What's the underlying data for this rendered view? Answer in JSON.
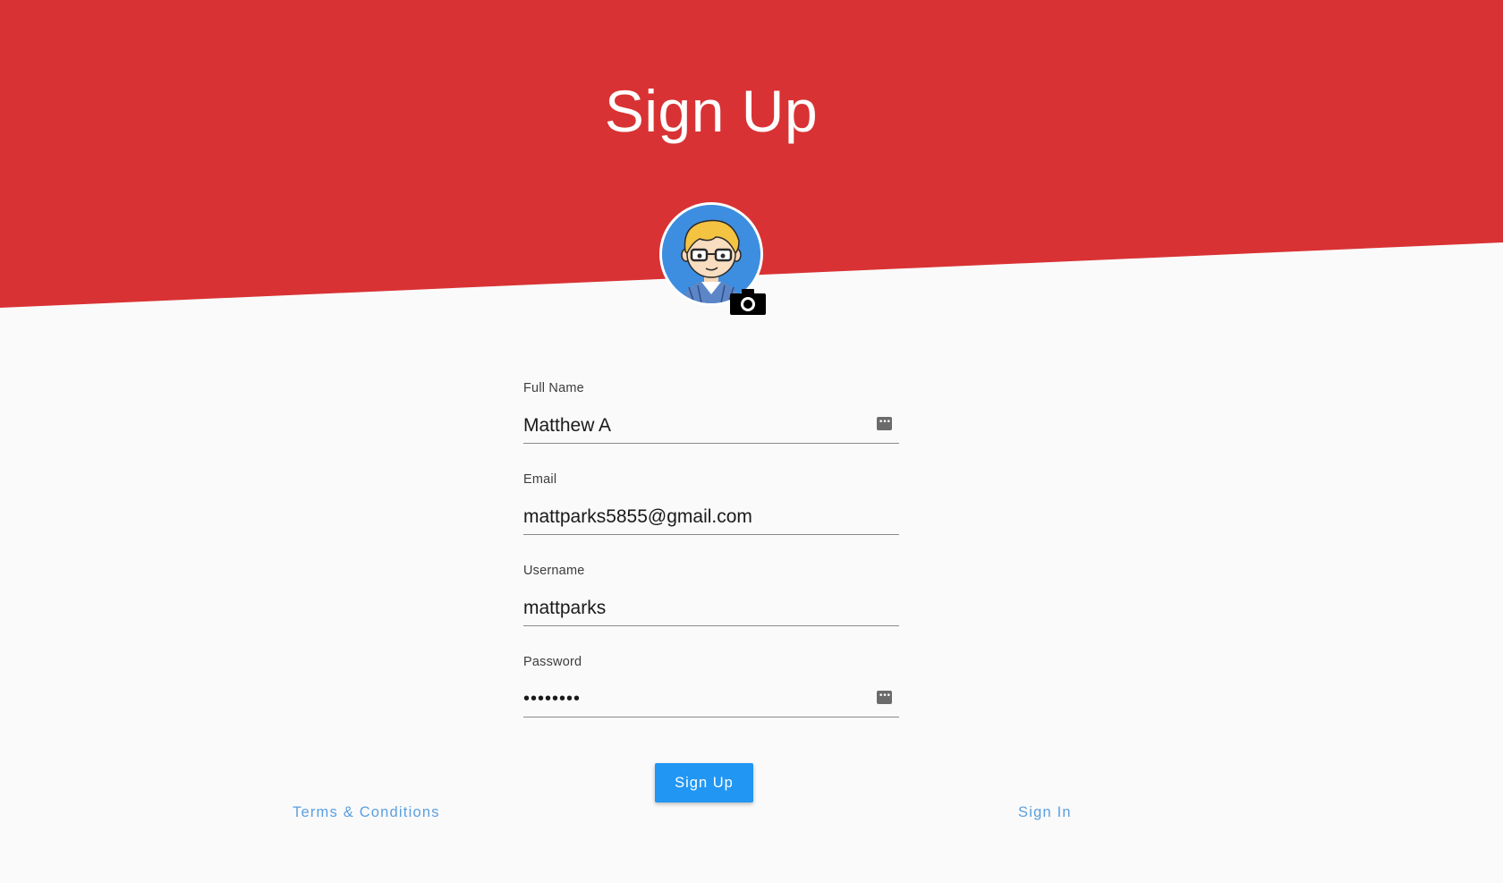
{
  "header": {
    "title": "Sign Up",
    "background_color": "#d93234"
  },
  "avatar": {
    "icon": "avatar-icon",
    "camera_icon": "camera-icon"
  },
  "form": {
    "full_name": {
      "label": "Full Name",
      "value": "Matthew A",
      "icon": "more-options-icon"
    },
    "email": {
      "label": "Email",
      "value": "mattparks5855@gmail.com"
    },
    "username": {
      "label": "Username",
      "value": "mattparks"
    },
    "password": {
      "label": "Password",
      "value": "••••••••",
      "icon": "more-options-icon"
    }
  },
  "actions": {
    "submit_label": "Sign Up",
    "submit_color": "#2196f3",
    "terms_label": "Terms & Conditions",
    "signin_label": "Sign In",
    "link_color": "#5b9fe0"
  }
}
